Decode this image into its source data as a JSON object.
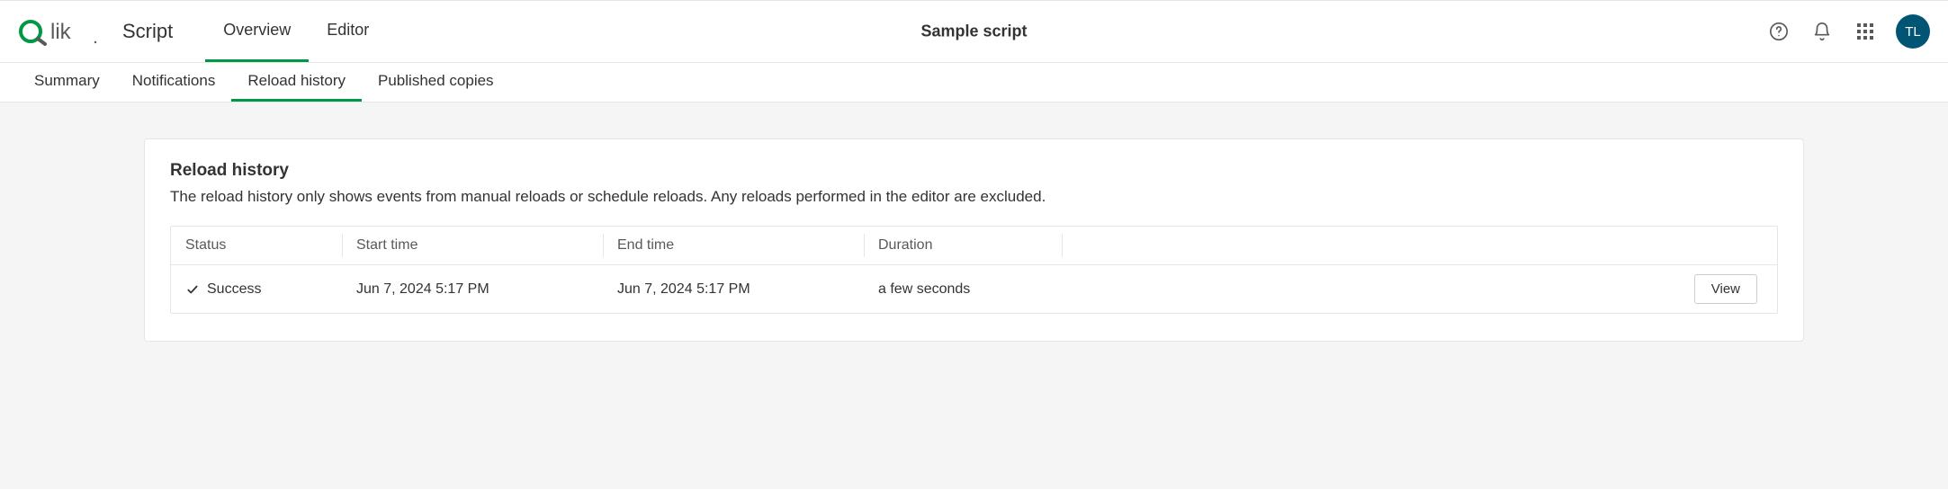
{
  "header": {
    "section": "Script",
    "tabs": [
      {
        "label": "Overview",
        "active": true
      },
      {
        "label": "Editor",
        "active": false
      }
    ],
    "page_title": "Sample script",
    "avatar_initials": "TL"
  },
  "subnav": {
    "tabs": [
      {
        "label": "Summary",
        "active": false
      },
      {
        "label": "Notifications",
        "active": false
      },
      {
        "label": "Reload history",
        "active": true
      },
      {
        "label": "Published copies",
        "active": false
      }
    ]
  },
  "panel": {
    "title": "Reload history",
    "description": "The reload history only shows events from manual reloads or schedule reloads. Any reloads performed in the editor are excluded."
  },
  "table": {
    "columns": [
      "Status",
      "Start time",
      "End time",
      "Duration",
      ""
    ],
    "rows": [
      {
        "status": "Success",
        "start_time": "Jun 7, 2024 5:17 PM",
        "end_time": "Jun 7, 2024 5:17 PM",
        "duration": "a few seconds",
        "action_label": "View"
      }
    ]
  },
  "icons": {
    "help": "help-icon",
    "bell": "bell-icon",
    "apps": "apps-grid-icon",
    "check": "check-icon"
  }
}
